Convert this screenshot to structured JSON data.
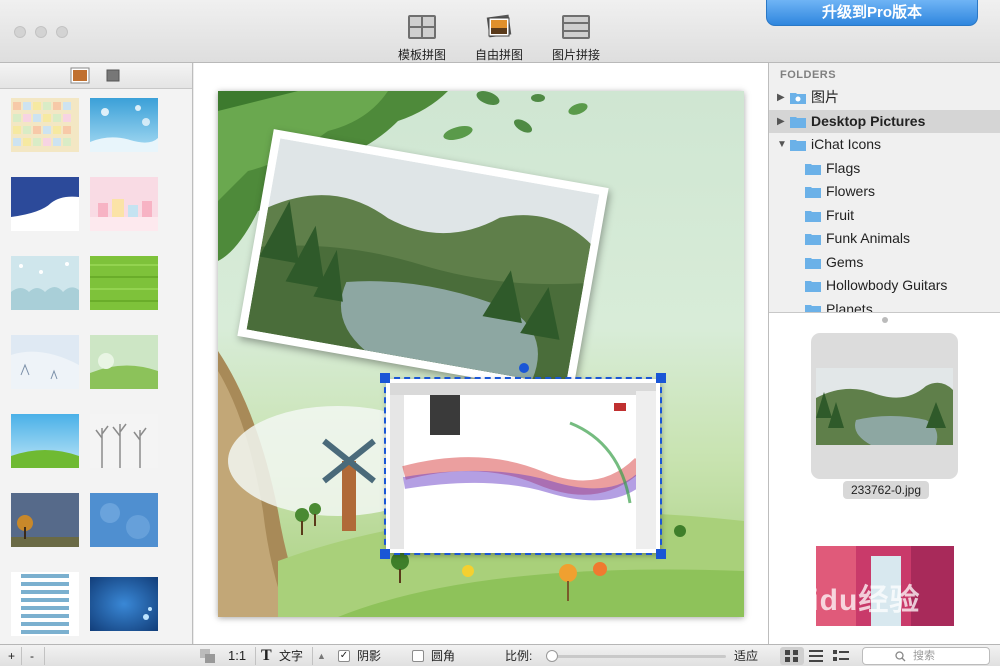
{
  "toolbar": {
    "template_collage": "模板拼图",
    "free_collage": "自由拼图",
    "photo_stitch": "图片拼接",
    "upgrade": "升级到Pro版本"
  },
  "folders": {
    "header": "FOLDERS",
    "items": [
      {
        "label": "图片",
        "level": 0,
        "expanded": false
      },
      {
        "label": "Desktop Pictures",
        "level": 0,
        "expanded": false,
        "selected": true
      },
      {
        "label": "iChat Icons",
        "level": 0,
        "expanded": true
      },
      {
        "label": "Flags",
        "level": 1
      },
      {
        "label": "Flowers",
        "level": 1
      },
      {
        "label": "Fruit",
        "level": 1
      },
      {
        "label": "Funk Animals",
        "level": 1
      },
      {
        "label": "Gems",
        "level": 1
      },
      {
        "label": "Hollowbody Guitars",
        "level": 1
      },
      {
        "label": "Planets",
        "level": 1
      }
    ]
  },
  "preview": {
    "selected_file": "233762-0.jpg"
  },
  "bottom_bar": {
    "add": "+",
    "remove": "-",
    "ratio_1_1": "1:1",
    "text_tool": "文字",
    "shadow": "阴影",
    "shadow_checked": true,
    "round_corner": "圆角",
    "round_corner_checked": false,
    "scale_label": "比例:",
    "fit": "适应",
    "scale_value": 0,
    "search_placeholder": "搜索"
  },
  "watermark": "Baidu经验",
  "colors": {
    "accent": "#2f86de",
    "selection": "#1a56d6",
    "folder": "#6bb1e8"
  }
}
